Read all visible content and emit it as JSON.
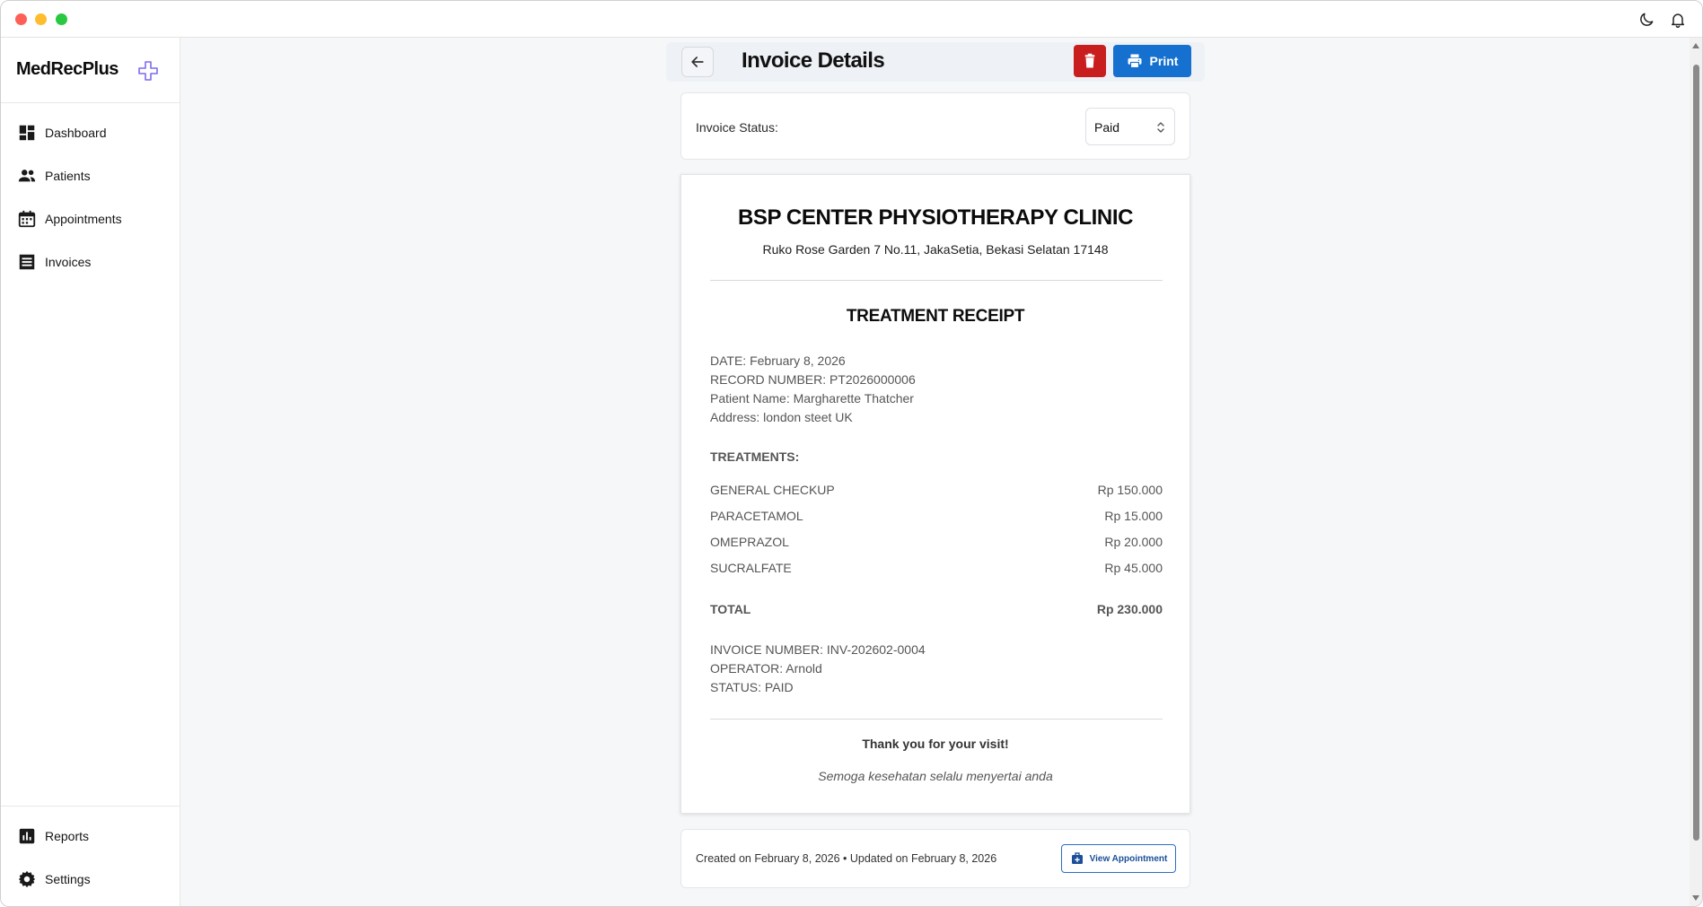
{
  "sidebar": {
    "brand": "MedRecPlus",
    "items": [
      {
        "label": "Dashboard"
      },
      {
        "label": "Patients"
      },
      {
        "label": "Appointments"
      },
      {
        "label": "Invoices"
      }
    ],
    "bottom_items": [
      {
        "label": "Reports"
      },
      {
        "label": "Settings"
      }
    ]
  },
  "header": {
    "title": "Invoice Details",
    "print_label": "Print"
  },
  "status": {
    "label": "Invoice Status:",
    "selected": "Paid"
  },
  "receipt": {
    "clinic_name": "BSP CENTER PHYSIOTHERAPY CLINIC",
    "clinic_address": "Ruko Rose Garden 7 No.11, JakaSetia, Bekasi Selatan 17148",
    "title": "TREATMENT RECEIPT",
    "date": "DATE: February 8, 2026",
    "record_number": "RECORD NUMBER: PT2026000006",
    "patient_name": "Patient Name: Margharette Thatcher",
    "address": "Address: london steet UK",
    "treatments_heading": "TREATMENTS:",
    "treatments": [
      {
        "name": "GENERAL CHECKUP",
        "price": "Rp 150.000"
      },
      {
        "name": "PARACETAMOL",
        "price": "Rp 15.000"
      },
      {
        "name": "OMEPRAZOL",
        "price": "Rp 20.000"
      },
      {
        "name": "SUCRALFATE",
        "price": "Rp 45.000"
      }
    ],
    "total_label": "TOTAL",
    "total_value": "Rp 230.000",
    "invoice_number": "INVOICE NUMBER: INV-202602-0004",
    "operator": "OPERATOR: Arnold",
    "status_line": "STATUS: PAID",
    "thanks": "Thank you for your visit!",
    "blessing": "Semoga kesehatan selalu menyertai anda"
  },
  "footer": {
    "meta": "Created on February 8, 2026 • Updated on February 8, 2026",
    "view_appointment_label": "View Appointment"
  },
  "colors": {
    "brand_icon": "#7c6cf0",
    "delete": "#c81e1e",
    "primary": "#1570cf"
  }
}
